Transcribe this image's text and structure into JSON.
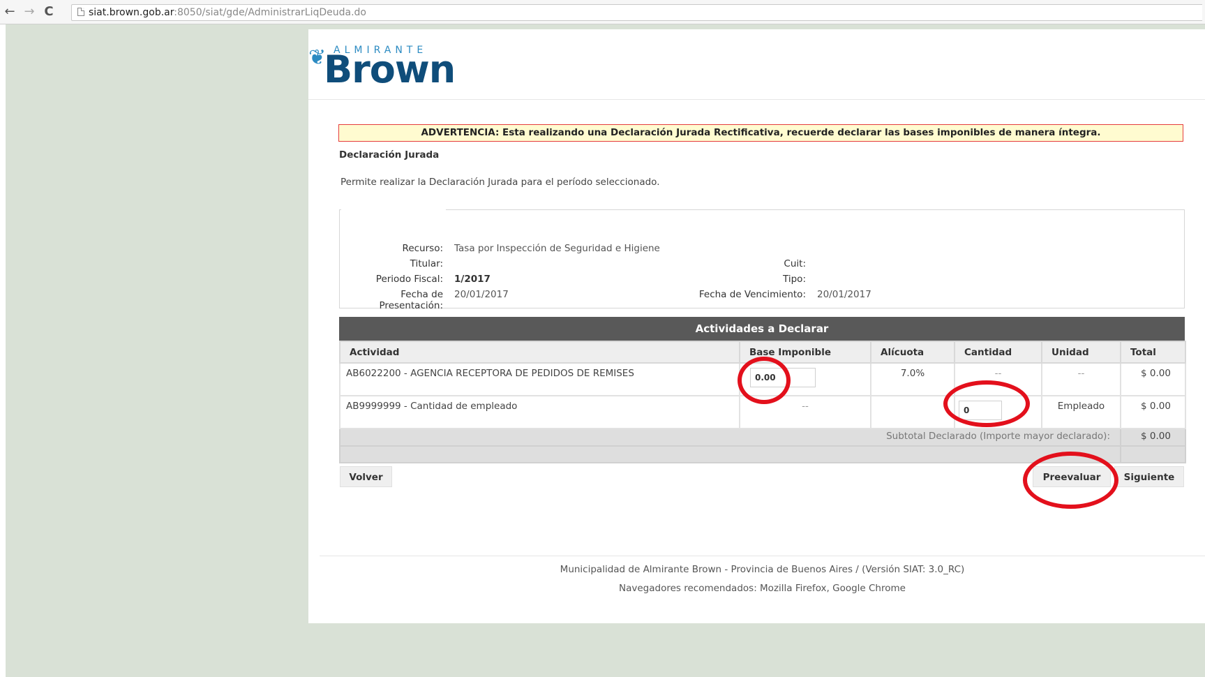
{
  "browser": {
    "url_host": "siat.brown.gob.ar",
    "url_rest": ":8050/siat/gde/AdministrarLiqDeuda.do"
  },
  "logo": {
    "sub": "ALMIRANTE",
    "main": "Brown"
  },
  "warning": "ADVERTENCIA: Esta realizando una Declaración Jurada Rectificativa, recuerde declarar las bases imponibles de manera íntegra.",
  "section": {
    "title": "Declaración Jurada",
    "description": "Permite realizar la Declaración Jurada para el período seleccionado."
  },
  "details": {
    "recurso_label": "Recurso:",
    "recurso_value": "Tasa por Inspección de Seguridad e Higiene",
    "titular_label": "Titular:",
    "titular_value": "",
    "cuit_label": "Cuit:",
    "cuit_value": "",
    "periodo_label": "Periodo Fiscal:",
    "periodo_value": "1/2017",
    "tipo_label": "Tipo:",
    "tipo_value": "",
    "presentacion_label": "Fecha de Presentación:",
    "presentacion_value": "20/01/2017",
    "vencimiento_label": "Fecha de Vencimiento:",
    "vencimiento_value": "20/01/2017"
  },
  "activities": {
    "title": "Actividades a Declarar",
    "columns": [
      "Actividad",
      "Base Imponible",
      "Alícuota",
      "Cantidad",
      "Unidad",
      "Total"
    ],
    "rows": [
      {
        "actividad": "AB6022200 - AGENCIA RECEPTORA DE PEDIDOS DE REMISES",
        "base": "0.00",
        "alicuota": "7.0%",
        "cantidad": "--",
        "unidad": "--",
        "total": "$ 0.00"
      },
      {
        "actividad": "AB9999999 - Cantidad de empleado",
        "base": "--",
        "alicuota": "",
        "cantidad": "0",
        "unidad": "Empleado",
        "total": "$ 0.00"
      }
    ],
    "subtotal_label": "Subtotal Declarado (Importe mayor declarado):",
    "subtotal_value": "$ 0.00"
  },
  "buttons": {
    "volver": "Volver",
    "preevaluar": "Preevaluar",
    "siguiente": "Siguiente"
  },
  "footer": {
    "line1": "Municipalidad de Almirante Brown - Provincia de Buenos Aires / (Versión SIAT: 3.0_RC)",
    "line2": "Navegadores recomendados: Mozilla Firefox, Google Chrome"
  },
  "colors": {
    "annotation": "#e3101c",
    "header_bar": "#595959",
    "warning_bg": "#fffbd0",
    "warning_border": "#e53c3c"
  }
}
